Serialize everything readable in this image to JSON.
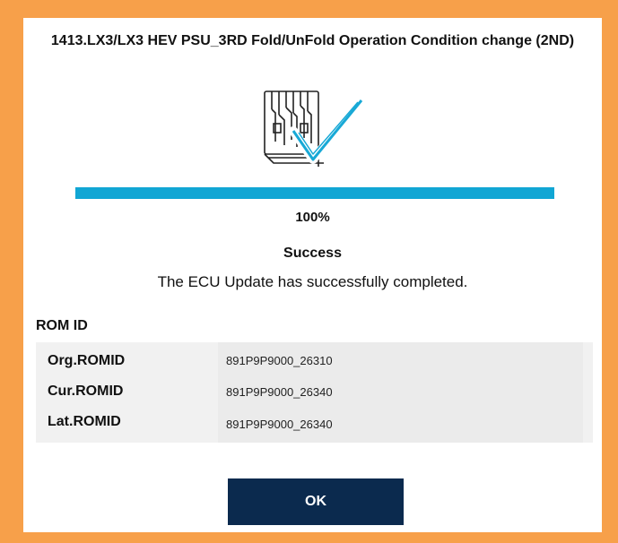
{
  "dialog": {
    "title": "1413.LX3/LX3 HEV PSU_3RD Fold/UnFold Operation Condition change (2ND)",
    "illustration_icon": "ecu-checkmark-icon"
  },
  "progress": {
    "value": 1.0,
    "label": "100%",
    "color": "#11a6d4"
  },
  "status": {
    "title": "Success",
    "message": "The ECU Update has successfully completed."
  },
  "rom": {
    "heading": "ROM ID",
    "rows": [
      {
        "label": "Org.ROMID",
        "value": "891P9P9000_26310"
      },
      {
        "label": "Cur.ROMID",
        "value": "891P9P9000_26340"
      },
      {
        "label": "Lat.ROMID",
        "value": "891P9P9000_26340"
      }
    ]
  },
  "actions": {
    "ok_label": "OK"
  },
  "colors": {
    "frame": "#f7a04a",
    "button": "#0b2a4e"
  }
}
